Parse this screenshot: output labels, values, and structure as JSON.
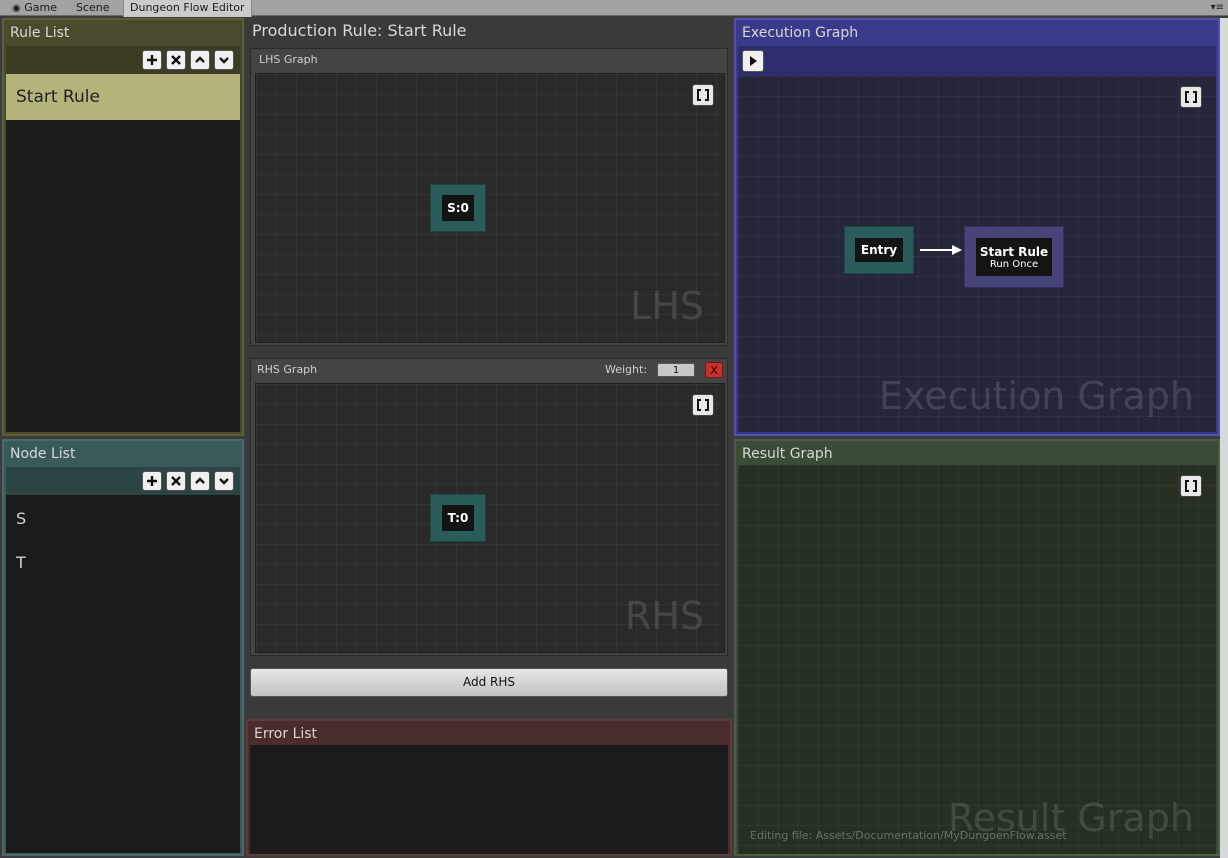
{
  "tabs": [
    {
      "label": "Game",
      "icon": "game-controller-icon"
    },
    {
      "label": "Scene"
    },
    {
      "label": "Dungeon Flow Editor",
      "active": true
    }
  ],
  "rule_list": {
    "title": "Rule List",
    "items": [
      "Start Rule"
    ],
    "selected": 0,
    "toolbar_icons": [
      "plus-icon",
      "cross-icon",
      "chevron-up-icon",
      "chevron-down-icon"
    ]
  },
  "node_list": {
    "title": "Node List",
    "items": [
      "S",
      "T"
    ],
    "toolbar_icons": [
      "plus-icon",
      "cross-icon",
      "chevron-up-icon",
      "chevron-down-icon"
    ]
  },
  "production_rule": {
    "title": "Production Rule: Start Rule",
    "lhs": {
      "label": "LHS Graph",
      "watermark": "LHS",
      "nodes": [
        {
          "label": "S:0"
        }
      ]
    },
    "rhs": {
      "label": "RHS Graph",
      "watermark": "RHS",
      "weight_label": "Weight:",
      "weight_value": "1",
      "remove_label": "X",
      "nodes": [
        {
          "label": "T:0"
        }
      ]
    },
    "add_rhs_label": "Add RHS"
  },
  "error_list": {
    "title": "Error List",
    "items": []
  },
  "execution_graph": {
    "title": "Execution Graph",
    "watermark": "Execution Graph",
    "nodes": [
      {
        "label": "Entry"
      },
      {
        "label": "Start Rule",
        "sublabel": "Run Once"
      }
    ]
  },
  "result_graph": {
    "title": "Result Graph",
    "watermark": "Result Graph",
    "status": "Editing file: Assets/Documentation/MyDungoenFlow.asset"
  },
  "colors": {
    "rule_list_bg": "#4a4a2c",
    "rule_selected": "#b3b37a",
    "node_list_bg": "#3a5a5a",
    "execution_bg": "#3a3a8a",
    "result_bg": "#3a4c36",
    "error_bg": "#4a2c2c",
    "node_teal": "#2a5c5c",
    "node_purple": "#45457a"
  }
}
